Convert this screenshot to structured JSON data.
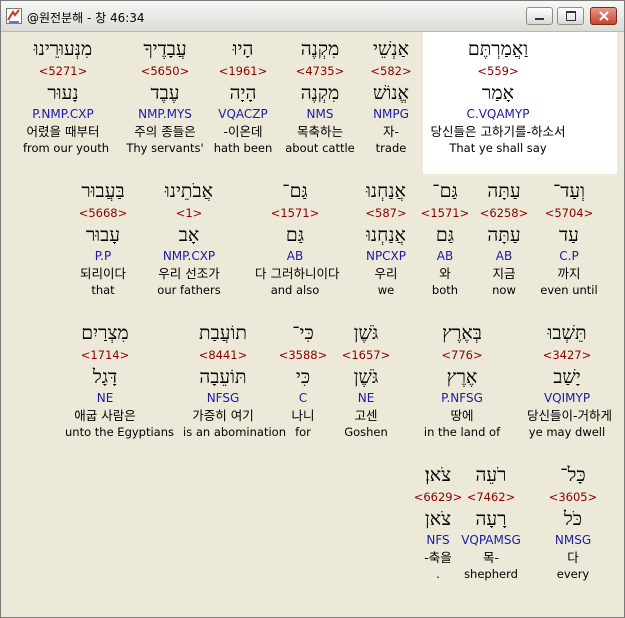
{
  "window": {
    "title": "@원전분해 - 창 46:34"
  },
  "rows": [
    [
      {
        "hebrew": "וַאֲמַרְתֶּם",
        "strong": "<559>",
        "lexeme": "אָמַר",
        "parsing": "C.VQAMYP",
        "korean": "당신들은 고하기를-하소서",
        "english": "That ye shall say",
        "highlighted": true
      },
      {
        "hebrew": "אַנְשֵׁי",
        "strong": "<582>",
        "lexeme": "אֱנוֹשׁ",
        "parsing": "NMPG",
        "korean": "자-",
        "english": "trade"
      },
      {
        "hebrew": "מִקְנֶה",
        "strong": "<4735>",
        "lexeme": "מִקְנֶה",
        "parsing": "NMS",
        "korean": "목축하는",
        "english": "about cattle"
      },
      {
        "hebrew": "הָיוּ",
        "strong": "<1961>",
        "lexeme": "הָיָה",
        "parsing": "VQACZP",
        "korean": "-이온데",
        "english": "hath been"
      },
      {
        "hebrew": "עֲבָדֶיךָ",
        "strong": "<5650>",
        "lexeme": "עֶבֶד",
        "parsing": "NMP.MYS",
        "korean": "주의 종들은",
        "english": "Thy servants'"
      },
      {
        "hebrew": "מִנְּעוּרֵינוּ",
        "strong": "<5271>",
        "lexeme": "נָעוּר",
        "parsing": "P.NMP.CXP",
        "korean": "어렸을 때부터",
        "english": "from our youth"
      }
    ],
    [
      {
        "hebrew": "וְעַד־",
        "strong": "<5704>",
        "lexeme": "עַד",
        "parsing": "C.P",
        "korean": "까지",
        "english": "even until"
      },
      {
        "hebrew": "עַתָּה",
        "strong": "<6258>",
        "lexeme": "עַתָּה",
        "parsing": "AB",
        "korean": "지금",
        "english": "now"
      },
      {
        "hebrew": "גַּם־",
        "strong": "<1571>",
        "lexeme": "גַּם",
        "parsing": "AB",
        "korean": "와",
        "english": "both"
      },
      {
        "hebrew": "אֲנַחְנוּ",
        "strong": "<587>",
        "lexeme": "אֲנַחְנוּ",
        "parsing": "NPCXP",
        "korean": "우리",
        "english": "we"
      },
      {
        "hebrew": "גַּם־",
        "strong": "<1571>",
        "lexeme": "גַּם",
        "parsing": "AB",
        "korean": "다 그러하니이다",
        "english": "and also"
      },
      {
        "hebrew": "אֲבֹתֵינוּ",
        "strong": "<1>",
        "lexeme": "אָב",
        "parsing": "NMP.CXP",
        "korean": "우리 선조가",
        "english": "our fathers"
      },
      {
        "hebrew": "בַּעֲבוּר",
        "strong": "<5668>",
        "lexeme": "עָבוּר",
        "parsing": "P.P",
        "korean": "되리이다",
        "english": "that"
      }
    ],
    [
      {
        "hebrew": "תֵּשְׁבוּ",
        "strong": "<3427>",
        "lexeme": "יָשַׁב",
        "parsing": "VQIMYP",
        "korean": "당신들이-거하게",
        "english": "ye may dwell"
      },
      {
        "hebrew": "בְּאֶרֶץ",
        "strong": "<776>",
        "lexeme": "אֶרֶץ",
        "parsing": "P.NFSG",
        "korean": "땅에",
        "english": "in the land of"
      },
      {
        "hebrew": "גֹּשֶׁן",
        "strong": "<1657>",
        "lexeme": "גֹּשֶׁן",
        "parsing": "NE",
        "korean": "고센",
        "english": "Goshen"
      },
      {
        "hebrew": "כִּי־",
        "strong": "<3588>",
        "lexeme": "כִּי",
        "parsing": "C",
        "korean": "나니",
        "english": "for"
      },
      {
        "hebrew": "תוֹעֲבַת",
        "strong": "<8441>",
        "lexeme": "תּוֹעֵבָה",
        "parsing": "NFSG",
        "korean": "가증히 여기",
        "english": "is an abomination"
      },
      {
        "hebrew": "מִצְרַיִם",
        "strong": "<1714>",
        "lexeme": "דָּגָל",
        "parsing": "NE",
        "korean": "애굽 사람은",
        "english": "unto the Egyptians"
      }
    ],
    [
      {
        "hebrew": "כָּל־",
        "strong": "<3605>",
        "lexeme": "כֹּל",
        "parsing": "NMSG",
        "korean": "다",
        "english": "every"
      },
      {
        "hebrew": "רֹעֵה",
        "strong": "<7462>",
        "lexeme": "רָעָה",
        "parsing": "VQPAMSG",
        "korean": "목-",
        "english": "shepherd"
      },
      {
        "hebrew": "צֹאן׃",
        "strong": "<6629>",
        "lexeme": "צֹאן",
        "parsing": "NFS",
        "korean": "-축을",
        "english": "."
      }
    ]
  ],
  "colors": {
    "strong": "#8b0000",
    "parsing": "#1a1aa6",
    "highlight": "#ffffff"
  }
}
